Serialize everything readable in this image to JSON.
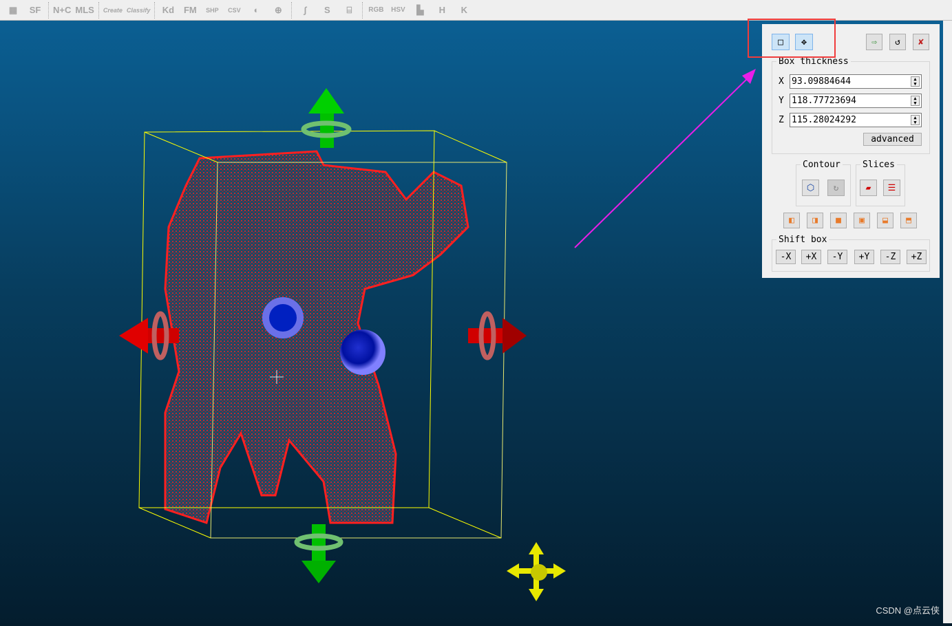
{
  "toolbar": {
    "items": [
      "calculator-icon",
      "SF",
      "N+C",
      "MLS",
      "Create",
      "Classify",
      "Kd",
      "FM",
      "SHP",
      "CSV",
      "color-wheel-icon",
      "sphere-grid-icon",
      "curve-icon",
      "points-curve-icon",
      "cylinder-icon",
      "RGB",
      "HSV",
      "bars-icon",
      "H",
      "K"
    ]
  },
  "panel": {
    "group_box_thickness": "Box thickness",
    "x_label": "X",
    "x_value": "93.09884644",
    "y_label": "Y",
    "y_value": "118.77723694",
    "z_label": "Z",
    "z_value": "115.28024292",
    "advanced": "advanced",
    "contour": "Contour",
    "slices": "Slices",
    "shift_box": "Shift box",
    "shift": [
      "-X",
      "+X",
      "-Y",
      "+Y",
      "-Z",
      "+Z"
    ]
  },
  "colors": {
    "cloud": "#ff1010",
    "box": "#ffff00",
    "annotation_arrow": "#e81ee8",
    "highlight": "#f03c3c"
  },
  "watermark": "CSDN @点云侠"
}
